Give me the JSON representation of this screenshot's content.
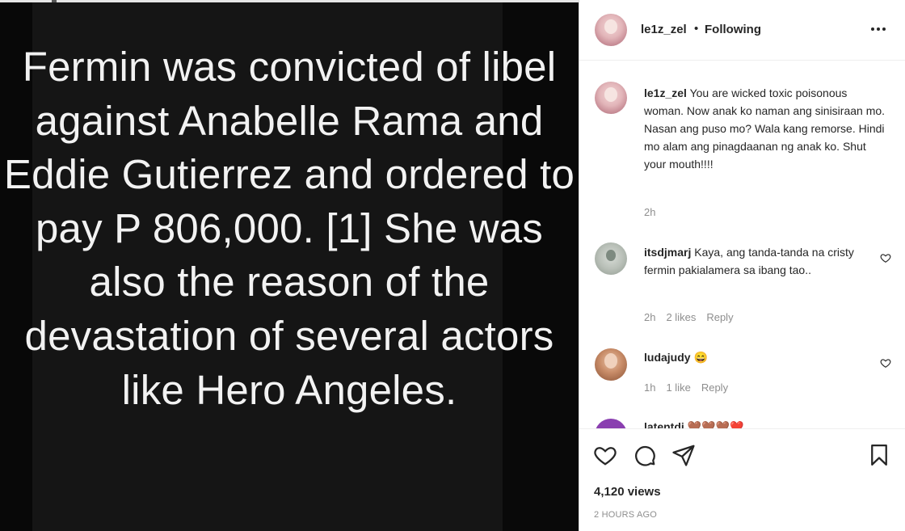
{
  "post": {
    "caption": "Fermin was convicted of libel against Anabelle Rama and Eddie Gutierrez and ordered to pay P 806,000. [1] She was also the reason of the devastation of several actors like Hero Angeles."
  },
  "header": {
    "username": "le1z_zel",
    "separator": "•",
    "follow_status": "Following"
  },
  "comments": [
    {
      "username": "le1z_zel",
      "text": "You are wicked toxic poisonous woman. Now anak ko naman ang sinisiraan mo. Nasan ang puso mo? Wala kang remorse. Hindi mo alam ang pinagdaanan ng anak ko. Shut your mouth!!!!",
      "time": "2h"
    },
    {
      "username": "itsdjmarj",
      "text": "Kaya, ang tanda-tanda na cristy fermin pakialamera sa ibang tao..",
      "time": "2h",
      "likes": "2 likes",
      "reply": "Reply"
    },
    {
      "username": "ludajudy",
      "text": "😄",
      "time": "1h",
      "likes": "1 like",
      "reply": "Reply"
    },
    {
      "username": "latentdi",
      "text": "🤎🤎🤎❤️"
    }
  ],
  "stats": {
    "views": "4,120 views",
    "time_ago": "2 HOURS AGO"
  },
  "icons": {
    "like": "heart-icon",
    "comment": "comment-icon",
    "share": "paper-plane-icon",
    "save": "bookmark-icon",
    "more": "more-icon"
  },
  "colors": {
    "media_background": "#151515",
    "caption_text": "#f2f2f2",
    "primary_text": "#262626",
    "secondary_text": "#8e8e8e"
  }
}
